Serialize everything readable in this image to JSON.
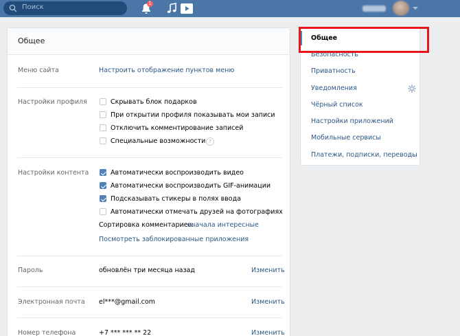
{
  "topbar": {
    "search_placeholder": "Поиск",
    "notifications_count": "1",
    "icons": [
      "search-icon",
      "bell-icon",
      "music-icon",
      "video-icon",
      "avatar"
    ]
  },
  "main": {
    "title": "Общее",
    "site_menu": {
      "label": "Меню сайта",
      "link": "Настроить отображение пунктов меню"
    },
    "profile": {
      "label": "Настройки профиля",
      "options": [
        {
          "text": "Скрывать блок подарков",
          "checked": false
        },
        {
          "text": "При открытии профиля показывать мои записи",
          "checked": false
        },
        {
          "text": "Отключить комментирование записей",
          "checked": false
        },
        {
          "text": "Специальные возможности",
          "checked": false
        }
      ],
      "help": "?"
    },
    "content": {
      "label": "Настройки контента",
      "options": [
        {
          "text": "Автоматически воспроизводить видео",
          "checked": true
        },
        {
          "text": "Автоматически воспроизводить GIF-анимации",
          "checked": true
        },
        {
          "text": "Подсказывать стикеры в полях ввода",
          "checked": true
        },
        {
          "text": "Автоматически отмечать друзей на фотографиях",
          "checked": false
        }
      ],
      "sort_label": "Сортировка комментариев:",
      "sort_value": "сначала интересные",
      "blocked_apps": "Посмотреть заблокированные приложения"
    },
    "password": {
      "label": "Пароль",
      "value": "обновлён три месяца назад",
      "action": "Изменить"
    },
    "email": {
      "label": "Электронная почта",
      "value": "el***@gmail.com",
      "action": "Изменить"
    },
    "phone": {
      "label": "Номер телефона",
      "value": "+7 *** *** ** 22",
      "action": "Изменить"
    }
  },
  "sidebar": {
    "items": [
      {
        "label": "Общее",
        "active": true
      },
      {
        "label": "Безопасность"
      },
      {
        "label": "Приватность"
      },
      {
        "label": "Уведомления"
      },
      {
        "label": "Чёрный список"
      },
      {
        "label": "Настройки приложений"
      },
      {
        "label": "Мобильные сервисы"
      },
      {
        "label": "Платежи, подписки, переводы"
      }
    ]
  },
  "colors": {
    "header": "#4a76a8",
    "link": "#2a5885",
    "accent": "#5181b8",
    "highlight": "#e8141b"
  }
}
